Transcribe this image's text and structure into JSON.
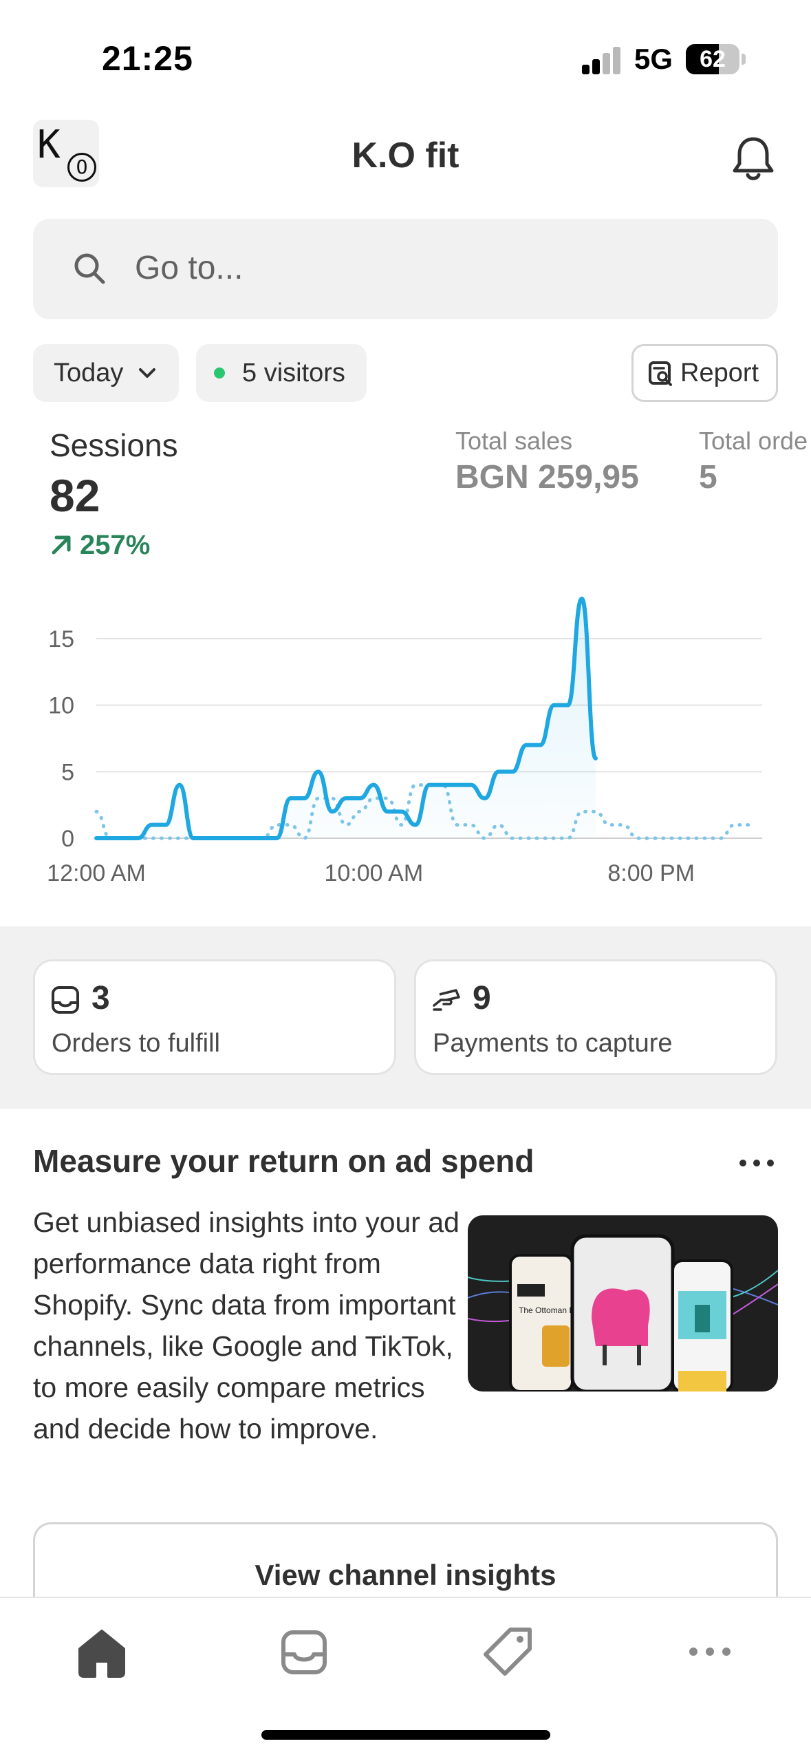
{
  "status_bar": {
    "time": "21:25",
    "network": "5G",
    "battery": "62"
  },
  "header": {
    "logo_text_top": "K",
    "logo_text_bottom": "O",
    "title": "K.O fit"
  },
  "search": {
    "placeholder": "Go to..."
  },
  "filters": {
    "date_range": "Today",
    "visitors": "5 visitors",
    "report_label": "Report"
  },
  "metrics": {
    "sessions": {
      "label": "Sessions",
      "value": "82",
      "change": "257%"
    },
    "total_sales": {
      "label": "Total sales",
      "value": "BGN 259,95"
    },
    "total_orders": {
      "label": "Total orde",
      "value": "5"
    }
  },
  "chart_data": {
    "type": "line",
    "x_ticks": [
      "12:00 AM",
      "10:00 AM",
      "8:00 PM"
    ],
    "y_ticks": [
      0,
      5,
      10,
      15
    ],
    "ylim": [
      0,
      18
    ],
    "grid": true,
    "x": [
      0,
      0.5,
      1,
      1.5,
      2,
      2.5,
      3,
      3.5,
      4,
      4.5,
      5,
      5.5,
      6,
      6.5,
      7,
      7.5,
      8,
      8.5,
      9,
      9.5,
      10,
      10.5,
      11,
      11.5,
      12,
      12.5,
      13,
      13.5,
      14,
      14.5,
      15,
      15.5,
      16,
      16.5,
      17,
      17.5,
      18,
      18.5,
      19,
      19.5,
      20,
      20.5,
      21,
      21.5,
      22,
      22.5,
      23,
      23.5
    ],
    "series": [
      {
        "values": [
          0,
          0,
          0,
          0,
          1,
          1,
          4,
          0,
          0,
          0,
          0,
          0,
          0,
          0,
          3,
          3,
          5,
          2,
          3,
          3,
          4,
          2,
          2,
          1,
          4,
          4,
          4,
          4,
          3,
          5,
          5,
          7,
          7,
          10,
          10,
          18,
          6,
          null,
          null,
          null,
          null,
          null,
          null,
          null,
          null,
          null,
          null,
          null
        ],
        "style": "solid",
        "color": "#1ea7e0"
      },
      {
        "values": [
          2,
          0,
          0,
          0,
          0,
          0,
          0,
          0,
          0,
          0,
          0,
          0,
          0,
          1,
          1,
          0,
          3,
          3,
          1,
          2,
          3,
          3,
          1,
          4,
          4,
          4,
          1,
          1,
          0,
          1,
          0,
          0,
          0,
          0,
          0,
          2,
          2,
          1,
          1,
          0,
          0,
          0,
          0,
          0,
          0,
          0,
          1,
          1
        ],
        "style": "dotted",
        "color": "#7cc4e8"
      }
    ]
  },
  "tasks": {
    "orders": {
      "count": "3",
      "label": "Orders to fulfill"
    },
    "payments": {
      "count": "9",
      "label": "Payments to capture"
    }
  },
  "promo": {
    "title": "Measure your return on ad spend",
    "body": "Get unbiased insights into your ad performance data right from Shopify. Sync data from important channels, like Google and TikTok, to more easily compare metrics and decide how to improve.",
    "image_caption": "The Ottoman Event",
    "cta_label": "View channel insights"
  },
  "colors": {
    "accent": "#1ea7e0",
    "positive": "#29845a",
    "live_dot": "#29c76f",
    "band": "#f1f1f1"
  },
  "tabbar": {
    "icons": [
      "home-icon",
      "orders-inbox-icon",
      "products-tag-icon",
      "more-icon"
    ]
  }
}
